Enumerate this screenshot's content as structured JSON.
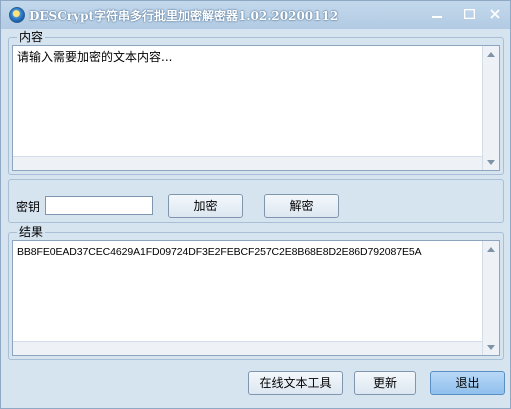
{
  "window": {
    "title": "DESCrypt字符串多行批里加密解密器1.02.20200112"
  },
  "content_group": {
    "label": "内容",
    "text": "请输入需要加密的文本内容..."
  },
  "key_row": {
    "label": "密钥",
    "value": "",
    "encrypt_label": "加密",
    "decrypt_label": "解密"
  },
  "result_group": {
    "label": "结果",
    "text": "BB8FE0EAD37CEC4629A1FD09724DF3E2FEBCF257C2E8B68E8D2E86D792087E5A"
  },
  "bottom_buttons": {
    "online_tools_label": "在线文本工具",
    "refresh_label": "更新",
    "exit_label": "退出"
  }
}
